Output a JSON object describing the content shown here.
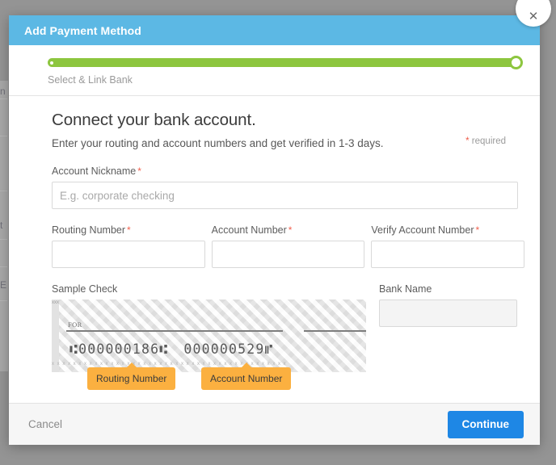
{
  "backdrop": {
    "fragments": [
      "n",
      "t",
      "E"
    ]
  },
  "modal": {
    "title": "Add Payment Method",
    "close_icon": "close-icon",
    "progress": {
      "step_label": "Select & Link Bank",
      "percent": 100,
      "fill_color": "#8dc63f"
    },
    "headline": "Connect your bank account.",
    "subhead": "Enter your routing and account numbers and get verified in 1-3 days.",
    "required_note": {
      "star": "*",
      "text": "required"
    },
    "fields": {
      "account_nickname": {
        "label": "Account Nickname",
        "required_marker": "*",
        "value": "",
        "placeholder": "E.g. corporate checking"
      },
      "routing_number": {
        "label": "Routing Number",
        "required_marker": "*",
        "value": "",
        "placeholder": ""
      },
      "account_number": {
        "label": "Account Number",
        "required_marker": "*",
        "value": "",
        "placeholder": ""
      },
      "verify_account_number": {
        "label": "Verify Account Number",
        "required_marker": "*",
        "value": "",
        "placeholder": ""
      },
      "bank_name": {
        "label": "Bank Name",
        "value": "",
        "placeholder": "",
        "disabled": true
      }
    },
    "sample_check": {
      "label": "Sample Check",
      "for_label": "FOR",
      "micr_routing": "⑆000000186⑆",
      "micr_account": "000000529⑈",
      "edge_marks": "xxxxxxxxxxxx",
      "bottom_marks": "x x x x x x x x x x x x x x x x x x x x x x x x x x x x x x x x x x x x x x x x x x x x",
      "callouts": {
        "routing": "Routing Number",
        "account": "Account Number"
      },
      "callout_color": "#fbb040"
    },
    "footer": {
      "cancel_label": "Cancel",
      "continue_label": "Continue",
      "continue_color": "#1e87e5"
    },
    "header_color": "#5cb8e4"
  }
}
